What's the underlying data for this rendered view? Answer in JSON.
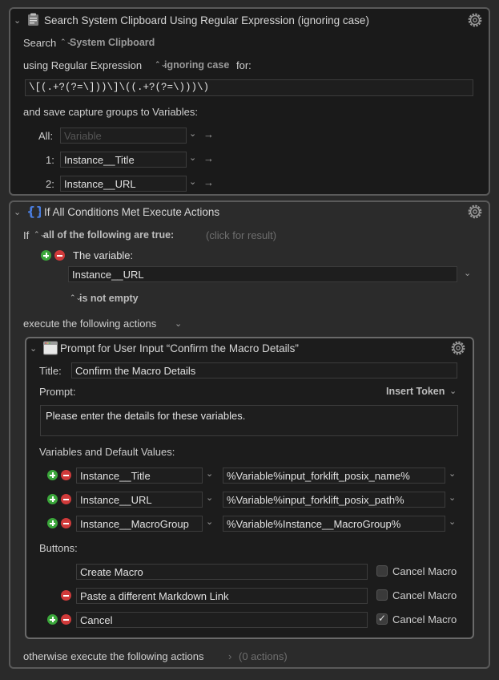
{
  "search_action": {
    "title": "Search System Clipboard Using Regular Expression (ignoring case)",
    "search_label": "Search",
    "source": "System Clipboard",
    "using_label": "using Regular Expression",
    "case_option": "ignoring case",
    "for_label": "for:",
    "regex": "\\[(.+?(?=\\]))\\]\\((.+?(?=\\)))\\)",
    "save_label": "and save capture groups to Variables:",
    "groups": [
      {
        "label": "All:",
        "value": "",
        "placeholder": "Variable"
      },
      {
        "label": "1:",
        "value": "Instance__Title",
        "placeholder": ""
      },
      {
        "label": "2:",
        "value": "Instance__URL",
        "placeholder": ""
      }
    ]
  },
  "if_action": {
    "title": "If All Conditions Met Execute Actions",
    "if_label": "If",
    "condition_mode": "all of the following are true:",
    "result_hint": "(click for result)",
    "condition_label": "The variable:",
    "variable_name": "Instance__URL",
    "operator": "is not empty",
    "execute_label": "execute the following actions",
    "otherwise_label": "otherwise execute the following actions",
    "otherwise_count": "(0 actions)"
  },
  "prompt_action": {
    "title": "Prompt for User Input “Confirm the Macro Details”",
    "title_label": "Title:",
    "title_value": "Confirm the Macro Details",
    "prompt_label": "Prompt:",
    "insert_token": "Insert Token",
    "prompt_text": "Please enter the details for these variables.",
    "vars_label": "Variables and Default Values:",
    "variables": [
      {
        "name": "Instance__Title",
        "default": "%Variable%input_forklift_posix_name%"
      },
      {
        "name": "Instance__URL",
        "default": "%Variable%input_forklift_posix_path%"
      },
      {
        "name": "Instance__MacroGroup",
        "default": "%Variable%Instance__MacroGroup%"
      }
    ],
    "buttons_label": "Buttons:",
    "buttons": [
      {
        "label": "Create Macro",
        "cancel_label": "Cancel Macro",
        "cancel_checked": false
      },
      {
        "label": "Paste a different Markdown Link",
        "cancel_label": "Cancel Macro",
        "cancel_checked": false
      },
      {
        "label": "Cancel",
        "cancel_label": "Cancel Macro",
        "cancel_checked": true
      }
    ]
  },
  "colors": {
    "background": "#2a2a2a",
    "field": "#1e1e1e",
    "border": "#5a5a5a",
    "plus": "#3aa63a",
    "minus": "#d03a3a"
  },
  "icons": [
    "disclosure-chevron-icon",
    "clipboard-action-icon",
    "gear-icon",
    "if-braces-icon",
    "prompt-window-icon",
    "plus-icon",
    "minus-icon",
    "arrow-right-icon",
    "checkbox-icon"
  ]
}
